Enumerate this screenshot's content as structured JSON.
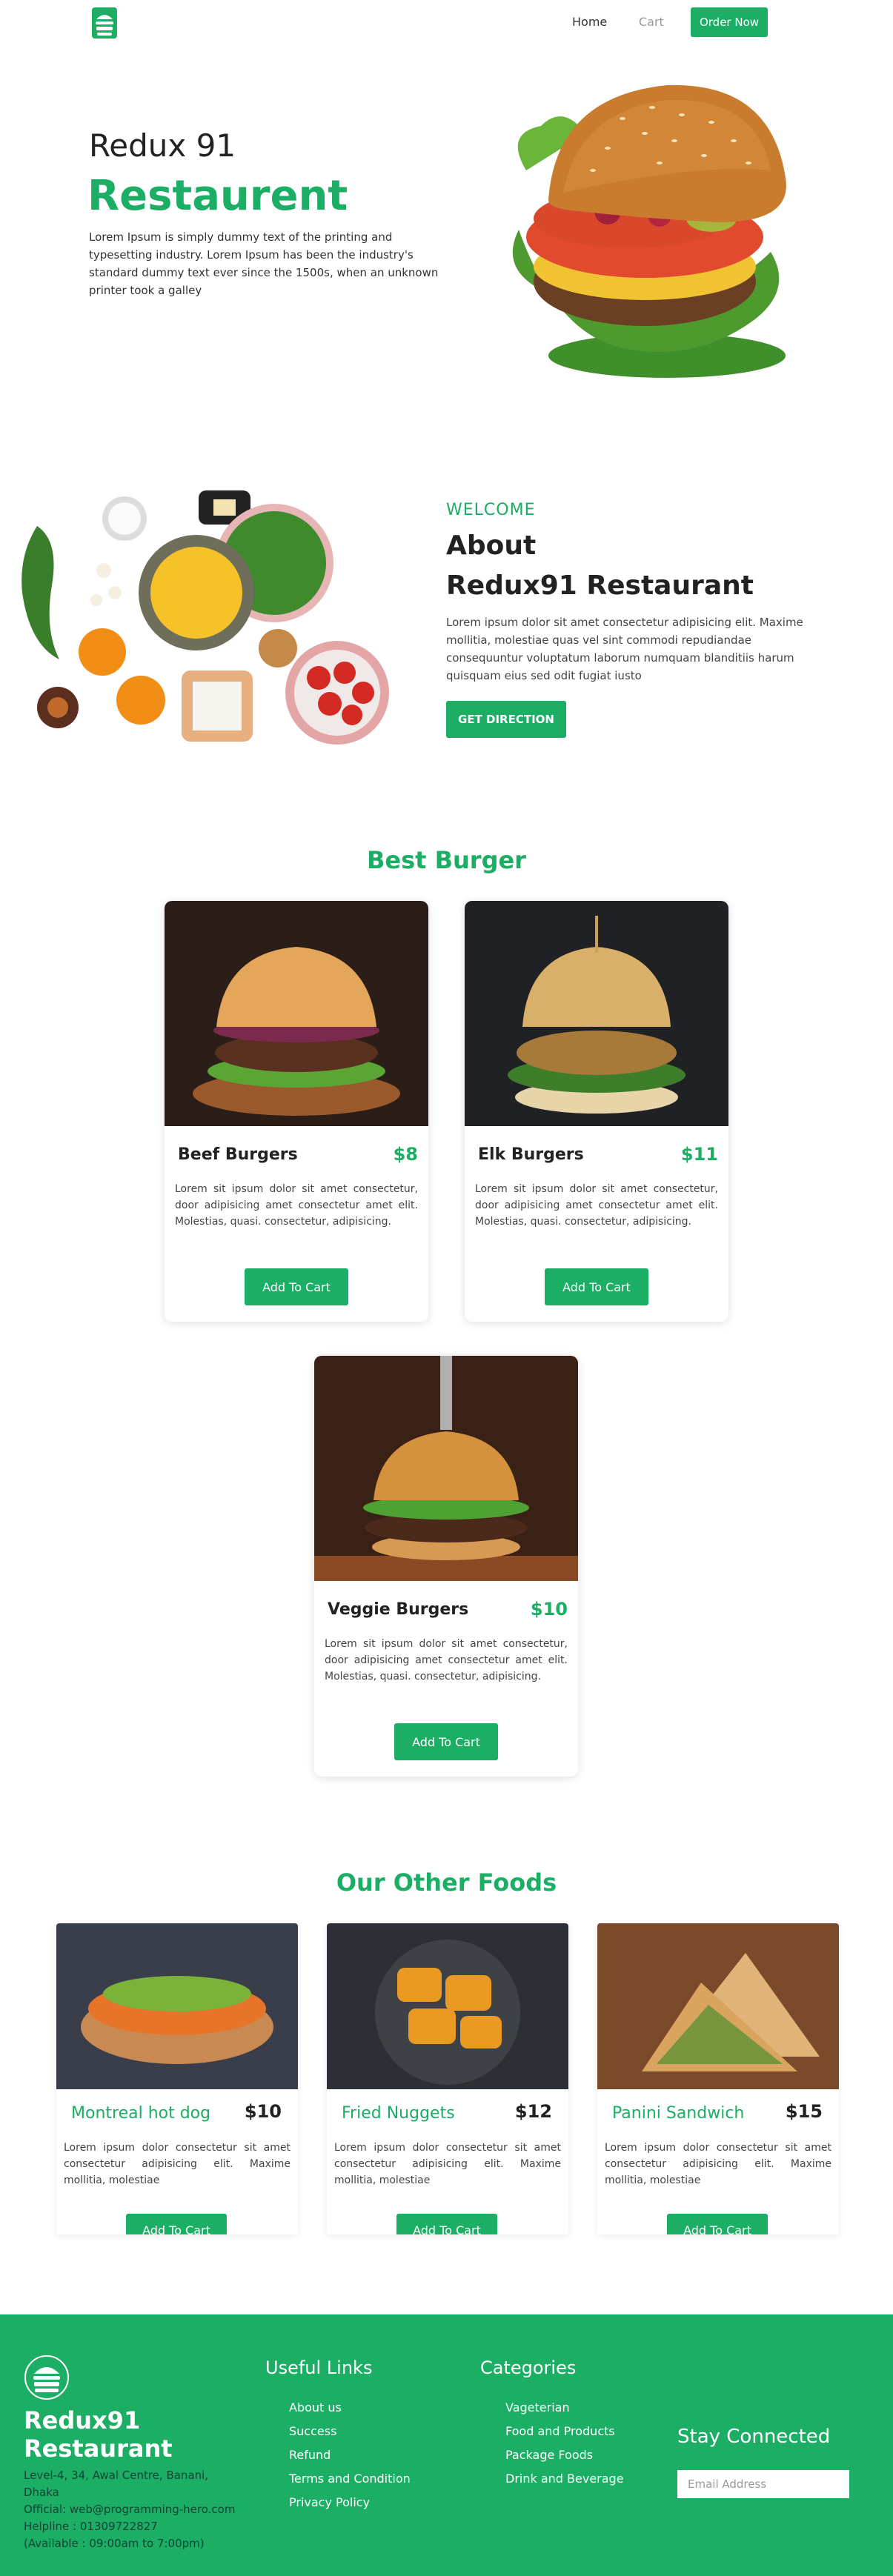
{
  "nav": {
    "logo_icon": "burger-logo-icon",
    "home_label": "Home",
    "cart_label": "Cart",
    "order_label": "Order Now"
  },
  "hero": {
    "subtitle": "Redux 91",
    "title": "Restaurent",
    "text": "Lorem Ipsum is simply dummy text of the printing and typesetting industry. Lorem Ipsum has been the industry's standard dummy text ever since the 1500s, when an unknown printer took a galley"
  },
  "about": {
    "welcome": "WELCOME",
    "heading_1": "About",
    "heading_2": "Redux91 Restaurant",
    "text": "Lorem ipsum dolor sit amet consectetur adipisicing elit. Maxime mollitia, molestiae quas vel sint commodi repudiandae consequuntur voluptatum laborum numquam blanditiis harum quisquam eius sed odit fugiat iusto",
    "button_label": "GET DIRECTION"
  },
  "best_burger": {
    "title": "Best Burger",
    "items": [
      {
        "name": "Beef Burgers",
        "price": "$8",
        "desc": "Lorem sit ipsum dolor sit amet consectetur, door adipisicing amet consectetur amet elit. Molestias, quasi. consectetur, adipisicing.",
        "button": "Add To Cart"
      },
      {
        "name": "Elk Burgers",
        "price": "$11",
        "desc": "Lorem sit ipsum dolor sit amet consectetur, door adipisicing amet consectetur amet elit. Molestias, quasi. consectetur, adipisicing.",
        "button": "Add To Cart"
      },
      {
        "name": "Veggie Burgers",
        "price": "$10",
        "desc": "Lorem sit ipsum dolor sit amet consectetur, door adipisicing amet consectetur amet elit. Molestias, quasi. consectetur, adipisicing.",
        "button": "Add To Cart"
      }
    ]
  },
  "other_foods": {
    "title": "Our Other Foods",
    "items": [
      {
        "name": "Montreal hot dog",
        "price": "$10",
        "desc": "Lorem ipsum dolor consectetur sit amet consectetur adipisicing elit. Maxime mollitia, molestiae",
        "button": "Add To Cart"
      },
      {
        "name": "Fried Nuggets",
        "price": "$12",
        "desc": "Lorem ipsum dolor consectetur sit amet consectetur adipisicing elit. Maxime mollitia, molestiae",
        "button": "Add To Cart"
      },
      {
        "name": "Panini Sandwich",
        "price": "$15",
        "desc": "Lorem ipsum dolor consectetur sit amet consectetur adipisicing elit. Maxime mollitia, molestiae",
        "button": "Add To Cart"
      }
    ]
  },
  "footer": {
    "brand_line_1": "Redux91",
    "brand_line_2": "Restaurant",
    "address": [
      "Level-4, 34, Awal Centre, Banani, Dhaka",
      "Official: web@programming-hero.com",
      "Helpline : 01309722827",
      "(Available : 09:00am to 7:00pm)"
    ],
    "useful_links_title": "Useful Links",
    "useful_links": [
      "About us",
      "Success",
      "Refund",
      "Terms and Condition",
      "Privacy Policy"
    ],
    "categories_title": "Categories",
    "categories": [
      "Vageterian",
      "Food and Products",
      "Package Foods",
      "Drink and Beverage"
    ],
    "stay_connected": "Stay Connected",
    "email_placeholder": "Email Address"
  },
  "colors": {
    "accent": "#1bae64"
  }
}
